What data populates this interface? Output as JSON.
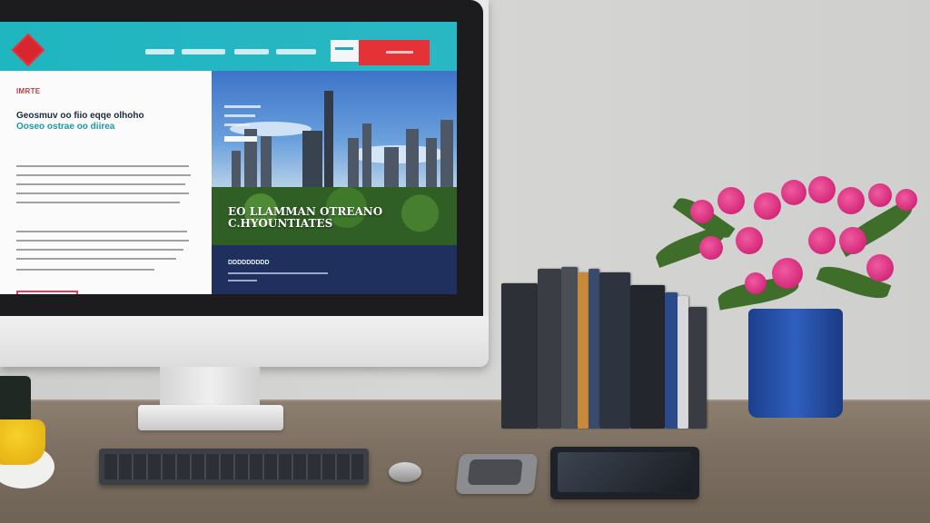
{
  "website": {
    "hero_heading": [
      "EO LLAMMAN OTREANO",
      "C.HYOUNTIATES"
    ],
    "left_tag": "IMRTE",
    "left_heading": [
      "Geosmuv oo fiio eqqe olhoho",
      "Ooseo ostrae oo diirea"
    ],
    "footer_title": "DDDDDDDDD"
  },
  "colors": {
    "nav_bar": "#1fb6c0",
    "nav_button_red": "#e53236",
    "cta_outline": "#e43c63",
    "footer_band": "#1f2f5e",
    "desk": "#7d7062",
    "wall": "#cdcdcb",
    "vase": "#2f5fbe",
    "flowers": "#d61b79"
  },
  "icons": {
    "logo": "diamond-logo-icon"
  }
}
